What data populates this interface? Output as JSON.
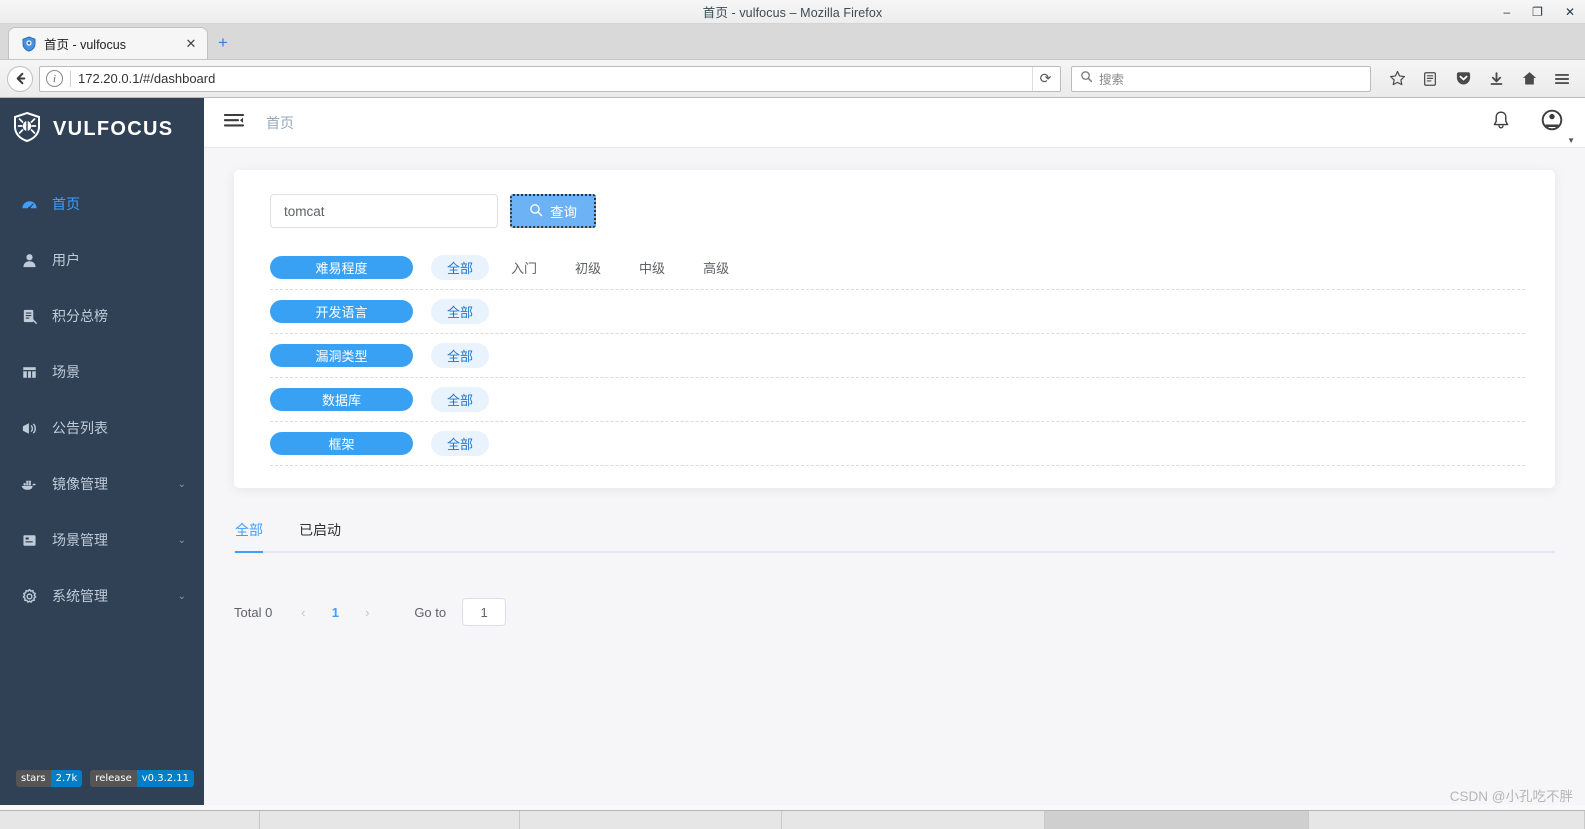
{
  "window": {
    "title": "首页 - vulfocus – Mozilla Firefox",
    "minimize": "–",
    "maximize": "❐",
    "close": "✕"
  },
  "browser": {
    "tab": {
      "title": "首页 - vulfocus",
      "close": "✕",
      "favicon": "shield-icon"
    },
    "newtab_label": "+",
    "back_label": "←",
    "url": "172.20.0.1/#/dashboard",
    "info_label": "i",
    "reload_label": "⟳",
    "search_placeholder": "搜索",
    "icons": [
      "bookmark-star-icon",
      "library-icon",
      "pocket-icon",
      "downloads-icon",
      "home-icon",
      "menu-icon"
    ]
  },
  "sidebar": {
    "brand": "VULFOCUS",
    "items": [
      {
        "label": "首页",
        "icon": "dashboard-icon",
        "active": true,
        "caret": ""
      },
      {
        "label": "用户",
        "icon": "user-icon",
        "active": false,
        "caret": ""
      },
      {
        "label": "积分总榜",
        "icon": "scoreboard-icon",
        "active": false,
        "caret": ""
      },
      {
        "label": "场景",
        "icon": "grid-icon",
        "active": false,
        "caret": ""
      },
      {
        "label": "公告列表",
        "icon": "megaphone-icon",
        "active": false,
        "caret": ""
      },
      {
        "label": "镜像管理",
        "icon": "docker-icon",
        "active": false,
        "caret": "⌄"
      },
      {
        "label": "场景管理",
        "icon": "panel-icon",
        "active": false,
        "caret": "⌄"
      },
      {
        "label": "系统管理",
        "icon": "gear-icon",
        "active": false,
        "caret": "⌄"
      }
    ],
    "badges": [
      {
        "left": "stars",
        "right": "2.7k"
      },
      {
        "left": "release",
        "right": "v0.3.2.11"
      }
    ]
  },
  "topbar": {
    "hamburger": "collapse-menu-icon",
    "breadcrumb": "首页",
    "bell": "bell-icon",
    "avatar": "avatar-icon",
    "avatar_caret": "▼"
  },
  "search": {
    "value": "tomcat",
    "placeholder": "",
    "button_label": "查询",
    "button_icon": "search-icon"
  },
  "filters": [
    {
      "label": "难易程度",
      "options": [
        {
          "text": "全部",
          "selected": true
        },
        {
          "text": "入门",
          "selected": false
        },
        {
          "text": "初级",
          "selected": false
        },
        {
          "text": "中级",
          "selected": false
        },
        {
          "text": "高级",
          "selected": false
        }
      ]
    },
    {
      "label": "开发语言",
      "options": [
        {
          "text": "全部",
          "selected": true
        }
      ]
    },
    {
      "label": "漏洞类型",
      "options": [
        {
          "text": "全部",
          "selected": true
        }
      ]
    },
    {
      "label": "数据库",
      "options": [
        {
          "text": "全部",
          "selected": true
        }
      ]
    },
    {
      "label": "框架",
      "options": [
        {
          "text": "全部",
          "selected": true
        }
      ]
    }
  ],
  "result_tabs": [
    {
      "label": "全部",
      "active": true
    },
    {
      "label": "已启动",
      "active": false
    }
  ],
  "pagination": {
    "total_label": "Total 0",
    "prev": "‹",
    "page": "1",
    "next": "›",
    "goto_label": "Go to",
    "goto_value": "1"
  },
  "watermark": "CSDN @小孔吃不胖",
  "colors": {
    "sidebar_bg": "#304156",
    "accent": "#409eff",
    "filter_tag": "#39a1f4",
    "selected_opt_bg": "#e8f3fe",
    "page_bg": "#f6f6f8"
  }
}
